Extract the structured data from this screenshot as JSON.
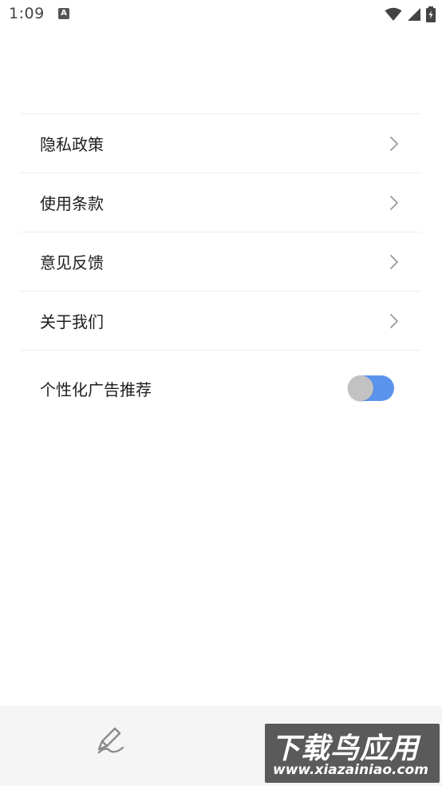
{
  "status_bar": {
    "time": "1:09",
    "notification_letter": "A"
  },
  "menu": {
    "items": [
      {
        "label": "隐私政策"
      },
      {
        "label": "使用条款"
      },
      {
        "label": "意见反馈"
      },
      {
        "label": "关于我们"
      }
    ],
    "toggle_item": {
      "label": "个性化广告推荐",
      "enabled": true
    }
  },
  "bottom_bar": {
    "watermark_title": "下载鸟应用",
    "watermark_url": "www.xiazainiao.com"
  },
  "colors": {
    "toggle_track": "#5c93ee",
    "toggle_knob": "#c2c2c2",
    "divider": "#efefef"
  }
}
